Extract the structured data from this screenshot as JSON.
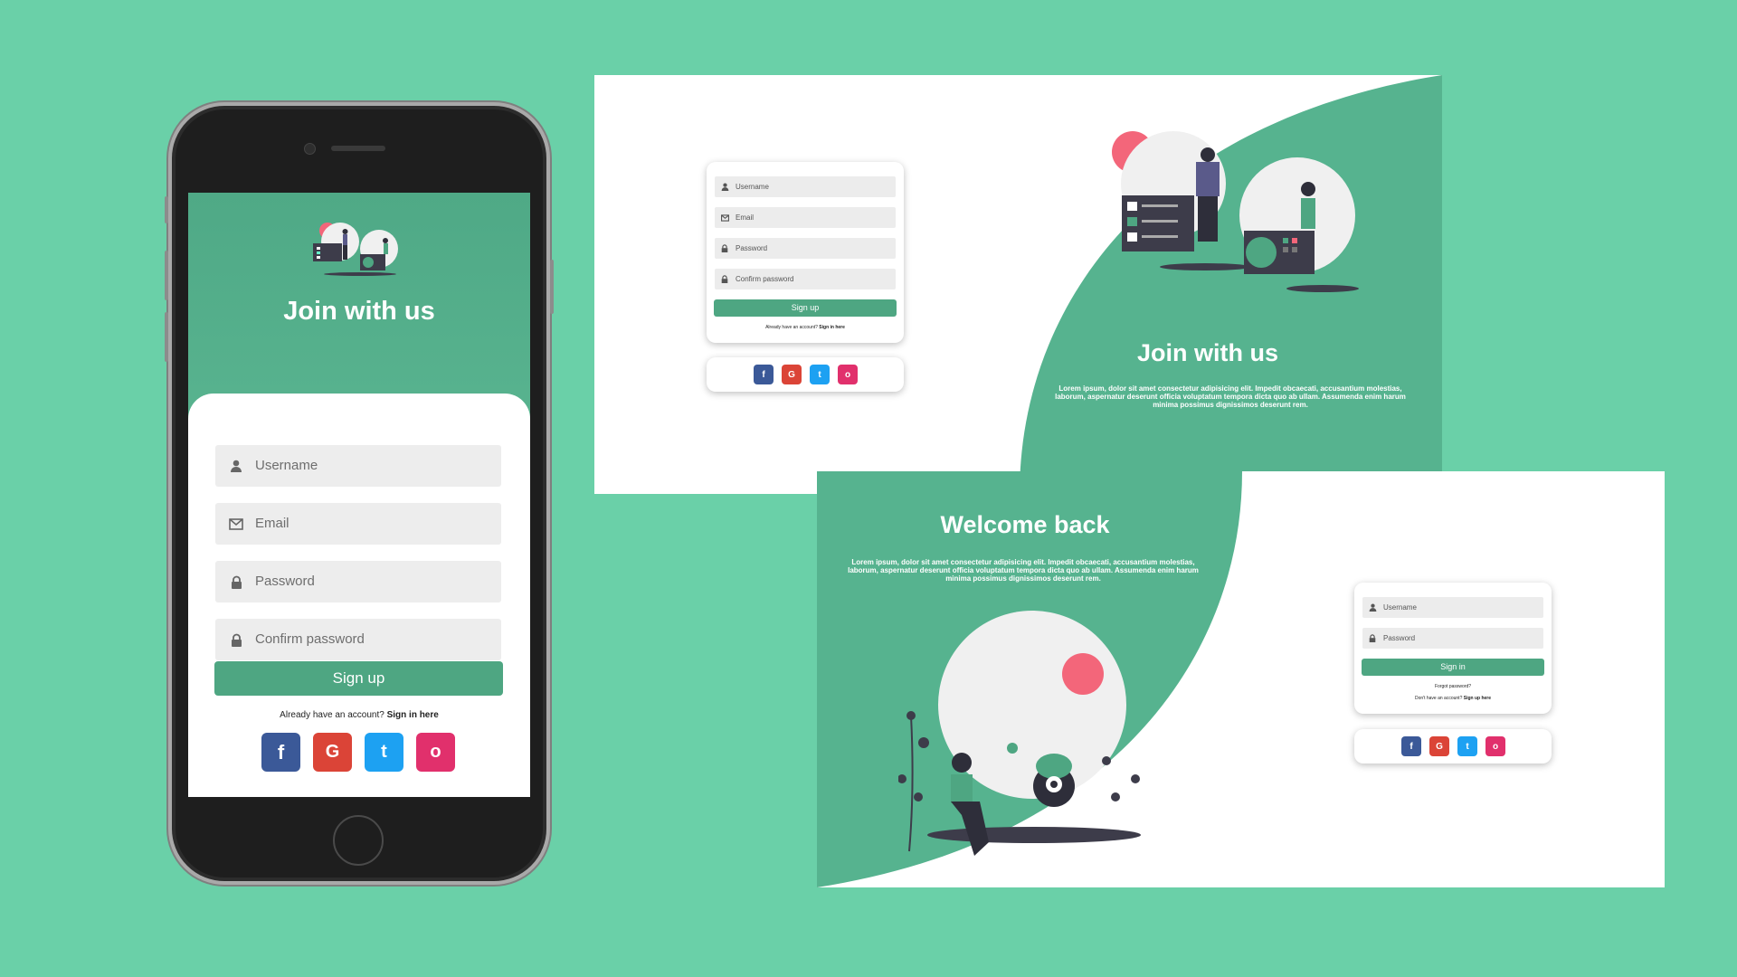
{
  "colors": {
    "background": "#6ad0a8",
    "accent": "#4ea682",
    "facebook": "#3b5998",
    "google": "#db4437",
    "twitter": "#1da1f2",
    "instagram": "#e1306c"
  },
  "mobile": {
    "title": "Join with us",
    "fields": [
      {
        "icon": "user-icon",
        "placeholder": "Username"
      },
      {
        "icon": "email-icon",
        "placeholder": "Email"
      },
      {
        "icon": "lock-icon",
        "placeholder": "Password"
      },
      {
        "icon": "lock-icon",
        "placeholder": "Confirm password"
      }
    ],
    "submit": "Sign up",
    "footer_text": "Already have an account?",
    "footer_link": "Sign in here",
    "social": [
      "f",
      "G",
      "t",
      "o"
    ]
  },
  "signup_desktop": {
    "title": "Join with us",
    "description": "Lorem ipsum, dolor sit amet consectetur adipisicing elit. Impedit obcaecati, accusantium molestias, laborum, aspernatur deserunt officia voluptatum tempora dicta quo ab ullam. Assumenda enim harum minima possimus dignissimos deserunt rem.",
    "fields": [
      {
        "icon": "user-icon",
        "placeholder": "Username"
      },
      {
        "icon": "email-icon",
        "placeholder": "Email"
      },
      {
        "icon": "lock-icon",
        "placeholder": "Password"
      },
      {
        "icon": "lock-icon",
        "placeholder": "Confirm password"
      }
    ],
    "submit": "Sign up",
    "footer_text": "Already have an account?",
    "footer_link": "Sign in here"
  },
  "signin_desktop": {
    "title": "Welcome back",
    "description": "Lorem ipsum, dolor sit amet consectetur adipisicing elit. Impedit obcaecati, accusantium molestias, laborum, aspernatur deserunt officia voluptatum tempora dicta quo ab ullam. Assumenda enim harum minima possimus dignissimos deserunt rem.",
    "fields": [
      {
        "icon": "user-icon",
        "placeholder": "Username"
      },
      {
        "icon": "lock-icon",
        "placeholder": "Password"
      }
    ],
    "submit": "Sign in",
    "forgot": "Forgot password?",
    "footer_text": "Don't have an account?",
    "footer_link": "Sign up here"
  }
}
